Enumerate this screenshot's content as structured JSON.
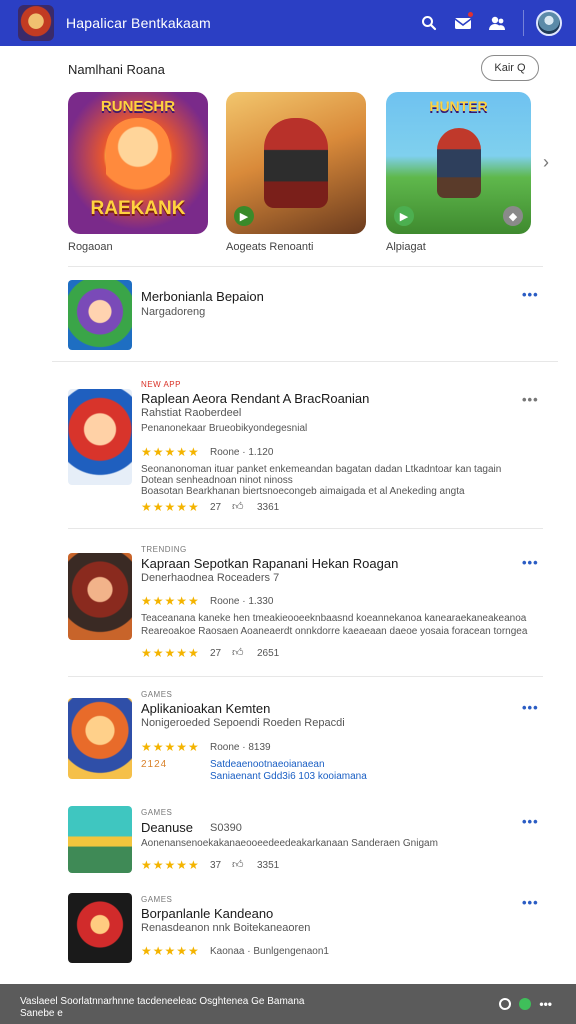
{
  "header": {
    "title": "Hapalicar Bentkakaam",
    "logo_icon": "game-logo",
    "icons": [
      "search-icon",
      "mail-icon",
      "users-icon"
    ],
    "accent": "#2b3fc4"
  },
  "featured": {
    "heading": "Namlhani Roana",
    "filter_label": "Kair Q",
    "items": [
      {
        "label": "Rogaoan",
        "top_text": "RUNESHR",
        "bottom_text": "RAEKANK"
      },
      {
        "label": "Aogeats Renoanti",
        "top_text": "",
        "bottom_text": ""
      },
      {
        "label": "Alpiagat",
        "top_text": "HUNTER",
        "bottom_text": ""
      }
    ]
  },
  "list": [
    {
      "kicker": "",
      "title": "Merbonianla Bepaion",
      "subtitle": "Nargadoreng"
    },
    {
      "kicker": "NEW APP",
      "title": "Raplean Aeora Rendant A BracRoanian",
      "subtitle": "Rahstiat Raoberdeel",
      "developer": "Penanonekaar Brueobikyondegesnial",
      "rating_label": "Roone · 1.120",
      "description": [
        "Seonanonoman ituar panket enkemeandan bagatan dadan Ltkadntoar kan tagain",
        "Dotean senheadnoan ninot ninoss",
        "Boasotan Bearkhanan biertsnoecongeb aimaigada et al Anekeding angta"
      ],
      "reviews": "27",
      "downloads": "3361"
    },
    {
      "kicker": "TRENDING",
      "title": "Kapraan Sepotkan Rapanani Hekan Roagan",
      "subtitle": "Denerhaodnea Roceaders 7",
      "rating_label": "Roone · 1.330",
      "description": [
        "Teaceanana kaneke hen tmeakieooeeknbaasnd koeannekanoa kanearaekaneakeanoa",
        "Reareoakoe Raosaen Aoaneaerdt onnkdorre kaeaeaan daeoe yosaia foracean torngea"
      ],
      "reviews": "27",
      "downloads": "2651"
    },
    {
      "kicker": "GAMES",
      "title": "Aplikanioakan Kemten",
      "subtitle": "Nonigeroeded Sepoendi Roeden Repacdi",
      "rating_label": "Roone · 8139",
      "promo_label": "2124",
      "link": "Satdeaenootnaeoianaean",
      "link2": "Saniaenant Gdd3i6 103 kooiamana"
    },
    {
      "kicker": "GAMES",
      "title": "Deanuse",
      "title_suffix": "S0390",
      "description": [
        "Aonenansenoekakanaeooeedeedeakarkanaan Sanderaen Gnigam"
      ],
      "reviews": "37",
      "downloads": "3351"
    },
    {
      "kicker": "GAMES",
      "title": "Borpanlanle Kandeano",
      "subtitle": "Renasdeanon nnk Boitekaneaoren",
      "rating_label": "Kaonaa · Bunlgengenaon1"
    }
  ],
  "footer": {
    "line1": "Vaslaeel Soorlatnnarhnne tacdeneeleac Osghtenea Ge Bamana",
    "line2": "Sanebe e"
  }
}
